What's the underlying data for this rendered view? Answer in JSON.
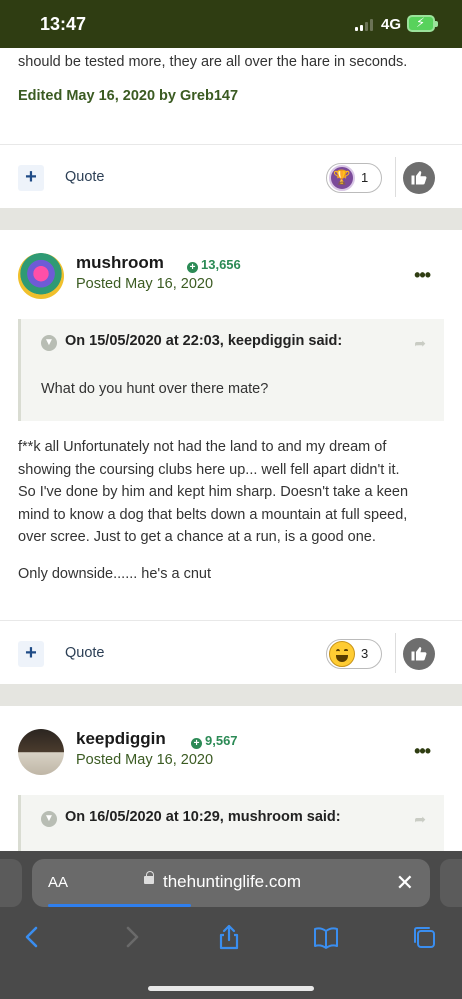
{
  "status_bar": {
    "time": "13:47",
    "network": "4G"
  },
  "post1": {
    "tail_text": "should be tested more, they are all over the hare in seconds.",
    "edited": "Edited May 16, 2020 by Greb147",
    "quote_label": "Quote",
    "reaction_count": "1",
    "reaction_icon": "trophy-icon"
  },
  "post2": {
    "username": "mushroom",
    "reputation": "13,656",
    "posted": "Posted May 16, 2020",
    "quote": {
      "header": "On 15/05/2020 at 22:03, keepdiggin said:",
      "body": "What do you hunt over there mate?"
    },
    "body_lines": [
      "f**k all       Unfortunately not had the land to and my dream of",
      "showing the coursing clubs here up... well fell apart didn't it.",
      "So I've done by him and kept him sharp. Doesn't take a keen",
      "mind to know a dog that belts down a mountain at full speed,",
      "over scree. Just to get a chance at a run, is a good one."
    ],
    "body_last": "Only downside...... he's a cnut",
    "quote_label": "Quote",
    "reaction_count": "3",
    "reaction_icon": "laugh-icon"
  },
  "post3": {
    "username": "keepdiggin",
    "reputation": "9,567",
    "posted": "Posted May 16, 2020",
    "quote": {
      "header": "On 16/05/2020 at 10:29, mushroom said:"
    }
  },
  "browser": {
    "text_size_label": "AA",
    "domain": "thehuntinglife.com",
    "page_load_progress": 0.36
  },
  "colors": {
    "status_bar": "#2f3d12",
    "accent_green": "#3b5b22",
    "reputation_green": "#2b8a55",
    "browser_toolbar": "#4a4a4a",
    "link_blue": "#2f7fee"
  }
}
